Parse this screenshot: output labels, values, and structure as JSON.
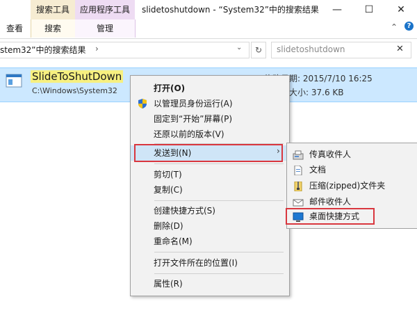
{
  "ribbon": {
    "ctx_search": "搜索工具",
    "ctx_app": "应用程序工具",
    "tab_view": "查看",
    "tab_search": "搜索",
    "tab_manage": "管理",
    "title": "slidetoshutdown - “System32”中的搜索结果",
    "minimize": "—",
    "maximize": "☐",
    "close": "✕",
    "collapse": "⌃",
    "help": "?"
  },
  "address": {
    "path": "stem32”中的搜索结果",
    "chevron": "›",
    "dropdown": "⌄",
    "refresh": "↻"
  },
  "search": {
    "value": "slidetoshutdown",
    "clear": "✕"
  },
  "item": {
    "name": "SlideToShutDown",
    "path": "C:\\Windows\\System32",
    "date": "修改日期: 2015/7/10 16:25",
    "size": "大小: 37.6 KB"
  },
  "menu": {
    "open": "打开(O)",
    "run_admin": "以管理员身份运行(A)",
    "pin_start": "固定到“开始”屏幕(P)",
    "restore": "还原以前的版本(V)",
    "send_to": "发送到(N)",
    "cut": "剪切(T)",
    "copy": "复制(C)",
    "create_shortcut": "创建快捷方式(S)",
    "delete": "删除(D)",
    "rename": "重命名(M)",
    "open_location": "打开文件所在的位置(I)",
    "properties": "属性(R)",
    "arrow": "›"
  },
  "submenu": {
    "fax": "传真收件人",
    "documents": "文档",
    "zip": "压缩(zipped)文件夹",
    "mail": "邮件收件人",
    "desktop": "桌面快捷方式"
  },
  "colors": {
    "accent_red": "#d9363e",
    "selection": "#cce8ff"
  }
}
